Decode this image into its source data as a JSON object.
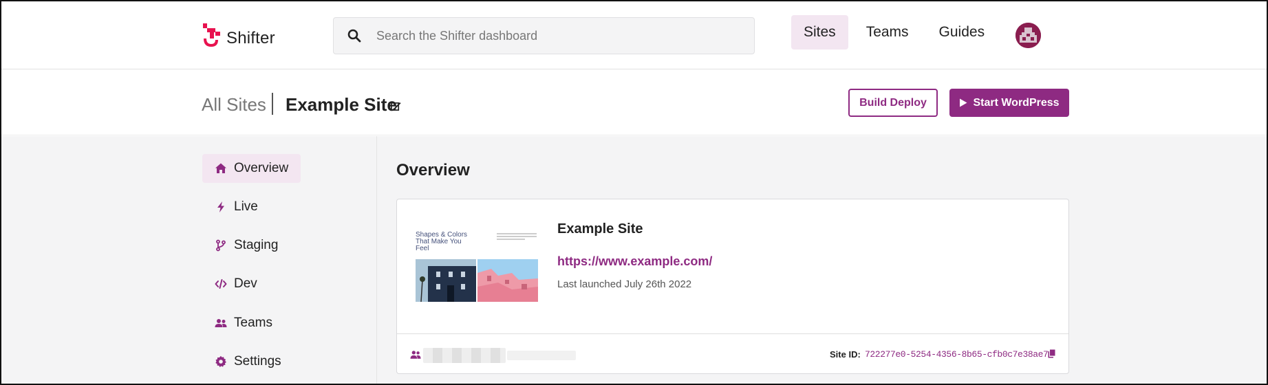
{
  "brand": {
    "name": "Shifter",
    "accent": "#8e2a82"
  },
  "search": {
    "placeholder": "Search the Shifter dashboard",
    "value": ""
  },
  "nav": {
    "items": [
      {
        "label": "Sites",
        "active": true
      },
      {
        "label": "Teams",
        "active": false
      },
      {
        "label": "Guides",
        "active": false
      }
    ]
  },
  "breadcrumb": {
    "all_label": "All Sites",
    "current": "Example Site"
  },
  "actions": {
    "build_label": "Build Deploy",
    "start_label": "Start WordPress"
  },
  "sidebar": {
    "items": [
      {
        "label": "Overview",
        "icon": "home-icon",
        "active": true
      },
      {
        "label": "Live",
        "icon": "bolt-icon"
      },
      {
        "label": "Staging",
        "icon": "branch-icon"
      },
      {
        "label": "Dev",
        "icon": "code-icon"
      },
      {
        "label": "Teams",
        "icon": "users-icon"
      },
      {
        "label": "Settings",
        "icon": "gear-icon"
      }
    ]
  },
  "main": {
    "title": "Overview",
    "card": {
      "thumbnail_heading": "Shapes & Colors That Make You Feel",
      "site_name": "Example Site",
      "url": "https://www.example.com/",
      "last_launched": "Last launched July 26th 2022",
      "site_id_label": "Site ID:",
      "site_id": "722277e0-5254-4356-8b65-cfb0c7e38ae7"
    }
  }
}
